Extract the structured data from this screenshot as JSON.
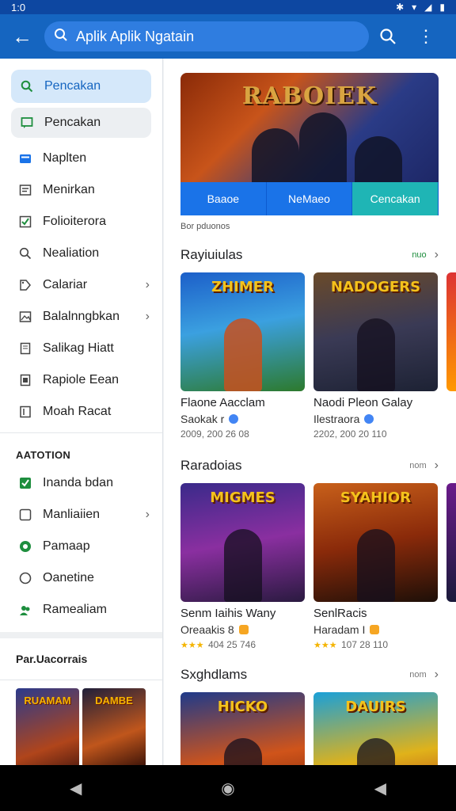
{
  "status_bar": {
    "time": "1:0",
    "icons": [
      "bluetooth-icon",
      "wifi-icon",
      "signal-icon",
      "battery-icon"
    ]
  },
  "app_bar": {
    "search_text": "Aplik Aplik Ngatain"
  },
  "sidebar": {
    "items": [
      {
        "label": "Pencakan",
        "icon": "search-icon"
      },
      {
        "label": "Pencakan",
        "icon": "chat-icon"
      },
      {
        "label": "Naplten",
        "icon": "folder-icon"
      },
      {
        "label": "Menirkan",
        "icon": "list-icon"
      },
      {
        "label": "Folioiterora",
        "icon": "checkbox-icon"
      },
      {
        "label": "Nealiation",
        "icon": "search-icon"
      },
      {
        "label": "Calariar",
        "icon": "tag-icon"
      },
      {
        "label": "Balalnngbkan",
        "icon": "image-icon"
      },
      {
        "label": "Salikag Hiatt",
        "icon": "document-icon"
      },
      {
        "label": "Rapiole Eean",
        "icon": "file-icon"
      },
      {
        "label": "Moah Racat",
        "icon": "book-icon"
      }
    ],
    "section_title": "AATOTION",
    "section_items": [
      {
        "label": "Inanda bdan",
        "icon": "checkbox-checked-icon"
      },
      {
        "label": "Manliaiien",
        "icon": "checkbox-empty-icon"
      },
      {
        "label": "Pamaap",
        "icon": "green-circle-icon"
      },
      {
        "label": "Oanetine",
        "icon": "circle-icon"
      },
      {
        "label": "Ramealiam",
        "icon": "people-icon"
      }
    ],
    "section2_title": "Par.Uacorrais",
    "thumbs": [
      "RUAMAM",
      "DAMBE"
    ]
  },
  "main": {
    "hero": {
      "title": "RABOIEK",
      "tabs": [
        "Baaoe",
        "NeMaeo",
        "Cencakan"
      ],
      "active_tab": 2,
      "caption": "Bor pduonos"
    },
    "rows": [
      {
        "title": "Rayiuiulas",
        "more": "nuo",
        "cards": [
          {
            "art": "ZHIMER",
            "name": "Flaone Aacclam",
            "sub": "Saokak r",
            "badge": "blue",
            "meta": "2009, 200 26 08"
          },
          {
            "art": "NADOGERS",
            "name": "Naodi Pleon Galay",
            "sub": "Ilestraora",
            "badge": "blue",
            "meta": "2202, 200 20 110"
          }
        ]
      },
      {
        "title": "Raradoias",
        "more": "nom",
        "cards": [
          {
            "art": "MIGMES",
            "name": "Senm Iaihis Wany",
            "sub": "Oreaakis 8",
            "badge": "orange",
            "meta": "404 25 746",
            "stars": "★★★"
          },
          {
            "art": "SYAHIOR",
            "name": "SenlRacis",
            "sub": "Haradam I",
            "badge": "orange",
            "meta": "107 28 110",
            "stars": "★★★"
          }
        ]
      },
      {
        "title": "Sxghdlams",
        "more": "nom",
        "cards": [
          {
            "art": "HICKO"
          },
          {
            "art": "DAUIRS"
          }
        ]
      }
    ]
  },
  "colors": {
    "app_bar": "#1565c0",
    "tab": "#1a73e8",
    "tab_active": "#1fb5b5",
    "accent_green": "#1e8e3e"
  }
}
